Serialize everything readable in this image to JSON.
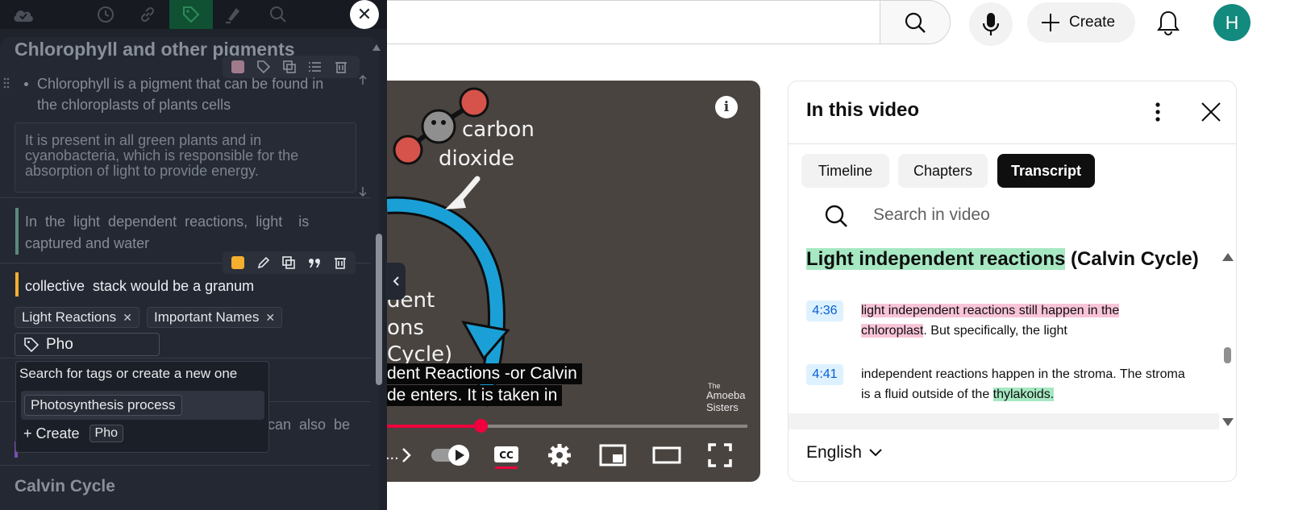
{
  "youtube": {
    "create_label": "Create",
    "avatar_initial": "H"
  },
  "player": {
    "art_text_1": "carbon",
    "art_text_2": "dioxide",
    "art_text_3": "dent",
    "art_text_4": "ons",
    "art_text_5": "Cycle)",
    "watermark_1": "The",
    "watermark_2": "Amoeba",
    "watermark_3": "Sisters",
    "caption_line_1": "dent Reactions -or Calvin",
    "caption_line_2": "de enters. It is taken in",
    "progress_fraction": 0.26,
    "info_label": "i",
    "chapter_truncated": "..."
  },
  "in_this_video": {
    "title": "In this video",
    "tabs": [
      {
        "label": "Timeline",
        "active": false
      },
      {
        "label": "Chapters",
        "active": false
      },
      {
        "label": "Transcript",
        "active": true
      }
    ],
    "search_placeholder": "Search in video",
    "chapter_highlight": "Light independent reactions",
    "chapter_rest": " (Calvin Cycle)",
    "segments": [
      {
        "time": "4:36",
        "line1_hl": "light independent reactions still happen in  the",
        "line2_hl": "chloroplast",
        "line2_rest": ". But specifically, the light"
      },
      {
        "time": "4:41",
        "line1": "independent reactions happen in the stroma. The  stroma",
        "line2_pre": "is a fluid outside of the ",
        "line2_hl": "thylakoids."
      }
    ],
    "language": "English"
  },
  "notes": {
    "heading": "Chlorophyll and other pigments",
    "bullet_line_1": "Chlorophyll is a pigment that can be found in",
    "bullet_line_2": "the  chloroplasts of plants cells",
    "quote": "It is present in all green plants and in cyanobacteria, which is responsible for the absorption of light to provide energy.",
    "block2_line_1": "In  the  light  dependent  reactions,  light    is",
    "block2_line_2": "captured and water",
    "block3_text": "collective  stack would be a granum",
    "tags": [
      "Light Reactions",
      "Important Names"
    ],
    "tag_remove_glyph": "✕",
    "tag_input_value": "Pho",
    "dropdown": {
      "hint": "Search for tags or create a new one",
      "option": "Photosynthesis process",
      "create_label": "+ Create",
      "create_value": "Pho"
    },
    "hidden_line_fragment": "can  also  be",
    "next_heading": "Calvin Cycle",
    "close_glyph": "✕",
    "colors": {
      "yellow_accent": "#f5ae2e",
      "mauve_accent": "#a07a8a",
      "green_accent": "#5c8a78",
      "active_toolbar": "#0f5132"
    }
  }
}
